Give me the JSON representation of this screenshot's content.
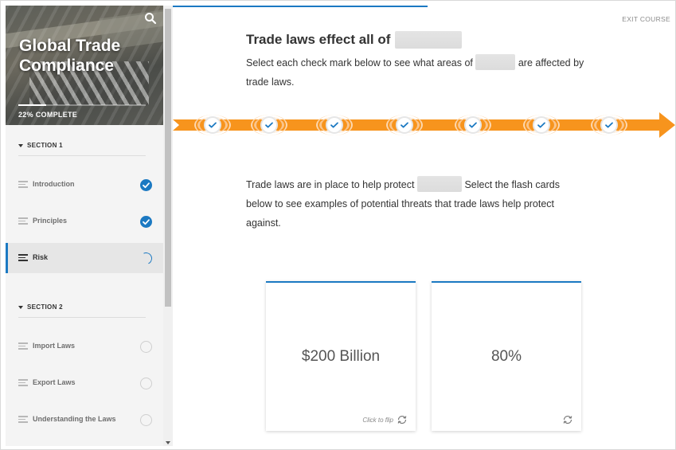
{
  "sidebar": {
    "course_title": "Global Trade Compliance",
    "progress_label": "22% COMPLETE",
    "progress_fraction": 0.22,
    "search_icon": "search-icon",
    "sections": [
      {
        "label": "SECTION 1",
        "lessons": [
          {
            "label": "Introduction",
            "status": "complete"
          },
          {
            "label": "Principles",
            "status": "complete"
          },
          {
            "label": "Risk",
            "status": "in-progress",
            "active": true
          }
        ]
      },
      {
        "label": "SECTION 2",
        "lessons": [
          {
            "label": "Import Laws",
            "status": "not-started"
          },
          {
            "label": "Export Laws",
            "status": "not-started"
          },
          {
            "label": "Understanding the Laws",
            "status": "not-started"
          }
        ]
      }
    ]
  },
  "main": {
    "exit_label": "EXIT COURSE",
    "heading": "Trade laws effect all of",
    "intro_before": "Select each check mark below to see what areas of",
    "intro_after": "are affected by trade laws.",
    "timeline_markers": 7,
    "protect_before": "Trade laws are in place to help protect",
    "protect_after": "Select the flash cards below to see examples of potential threats that trade laws help protect against.",
    "cards": [
      {
        "value": "$200 Billion",
        "flip_label": "Click to flip"
      },
      {
        "value": "80%",
        "flip_label": ""
      }
    ]
  },
  "colors": {
    "accent_blue": "#1b79c2",
    "timeline_orange": "#f7941d"
  }
}
